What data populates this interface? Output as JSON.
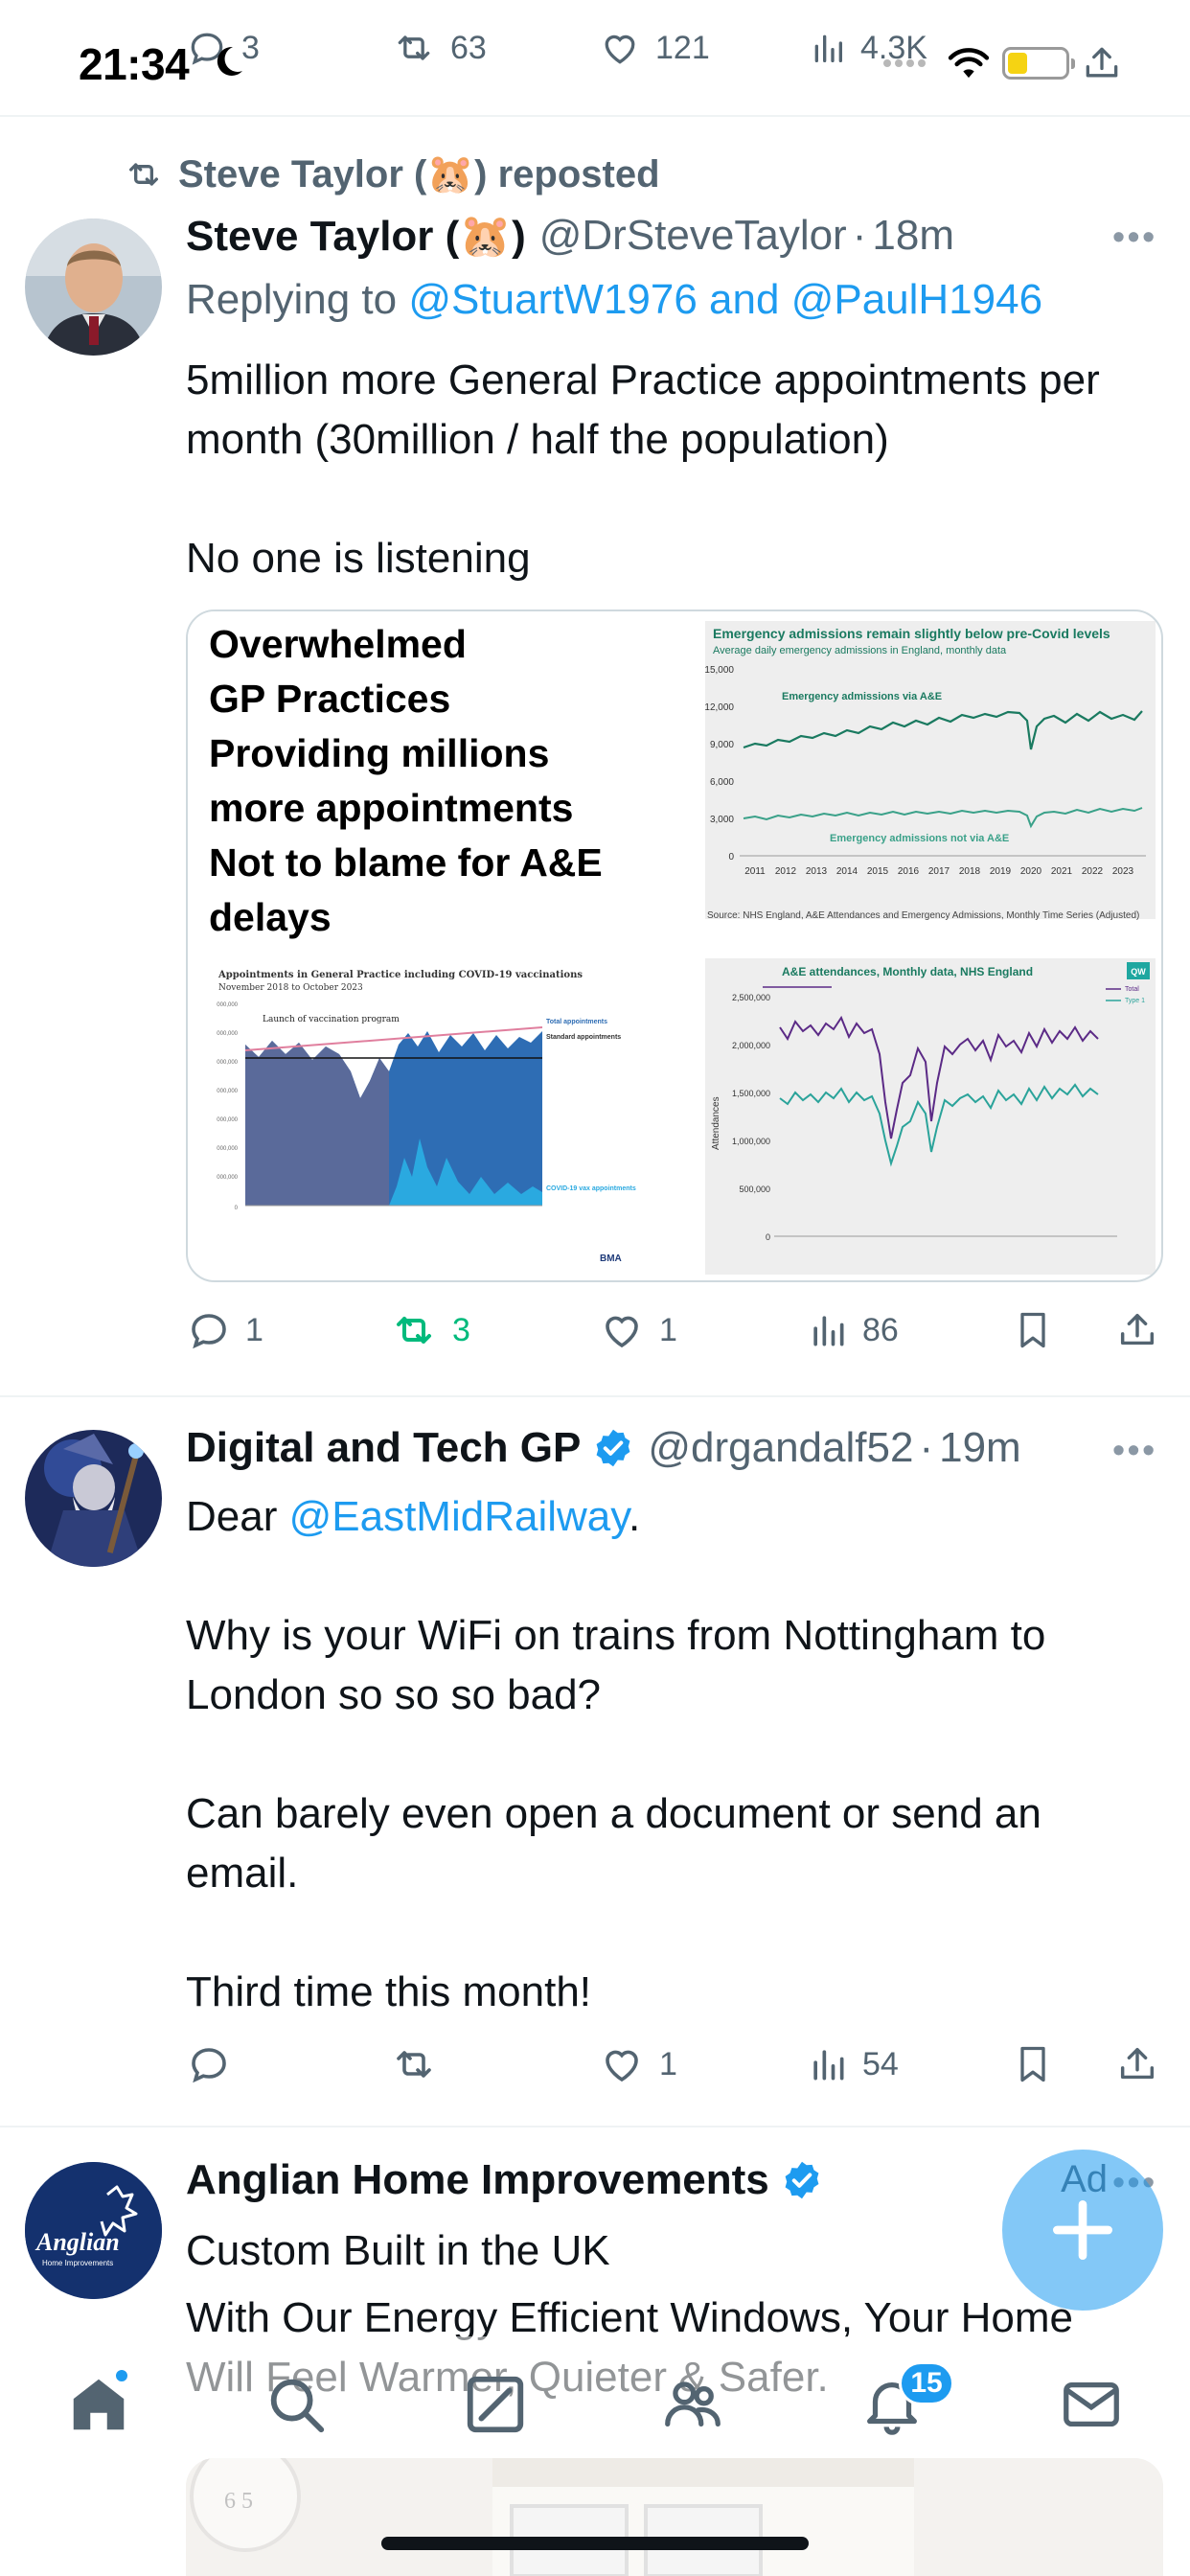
{
  "status_bar": {
    "time": "21:34"
  },
  "prev_tweet": {
    "reply_count": "3",
    "repost_count": "63",
    "like_count": "121",
    "view_count": "4.3K"
  },
  "tweet1": {
    "retweet_context": "Steve Taylor (🐹) reposted",
    "display_name": "Steve Taylor (🐹)",
    "handle": "@DrSteveTaylor",
    "time": "18m",
    "reply_prefix": "Replying to ",
    "reply_mentions": "@StuartW1976 and @PaulH1946",
    "text_line1": "5million more General Practice appointments per month (30million / half the population)",
    "text_line2": "No one is listening",
    "media": {
      "headline": [
        "Overwhelmed",
        "GP Practices",
        "Providing millions",
        "more appointments",
        "Not to blame for A&E",
        "delays"
      ],
      "chart1": {
        "title": "Emergency admissions remain slightly below pre-Covid levels",
        "subtitle": "Average daily emergency admissions in England, monthly data",
        "series_a": "Emergency admissions via A&E",
        "series_b": "Emergency admissions not via A&E",
        "source": "Source: NHS England, A&E Attendances and Emergency Admissions, Monthly Time Series (Adjusted)"
      },
      "chart2": {
        "title": "Appointments in General Practice including COVID-19 vaccinations",
        "subtitle": "November 2018 to October 2023",
        "launch": "Launch of vaccination program",
        "legend_total": "Total appointments",
        "legend_standard": "Standard appointments",
        "legend_covid": "COVID-19 vax appointments",
        "brand": "BMA"
      },
      "chart3": {
        "title": "A&E attendances, Monthly data, NHS England",
        "ylabel": "Attendances",
        "legend_total": "Total",
        "legend_type1": "Type 1",
        "brand": "QW"
      }
    },
    "reply_count": "1",
    "repost_count": "3",
    "like_count": "1",
    "view_count": "86"
  },
  "tweet2": {
    "display_name": "Digital and Tech GP",
    "handle": "@drgandalf52",
    "time": "19m",
    "greeting": "Dear ",
    "mention": "@EastMidRailway",
    "greeting_end": ".",
    "para1": "Why is your WiFi on trains from Nottingham to London so so so bad?",
    "para2": "Can barely even open a document or send an email.",
    "para3": "Third time this month!",
    "like_count": "1",
    "view_count": "54"
  },
  "ad": {
    "display_name": "Anglian Home Improvements",
    "label": "Ad",
    "headline": "Custom Built in the UK",
    "text": "With Our Energy Efficient Windows, Your Home Will Feel Warmer, Quieter & Safer.",
    "logo_text": "Anglian",
    "logo_sub": "Home Improvements"
  },
  "nav": {
    "notification_badge": "15"
  },
  "colors": {
    "accent": "#1d9bf0",
    "repost_green": "#00ba7c",
    "muted": "#536471",
    "chart_teal": "#1a7a60",
    "chart_purple": "#5b2a86"
  }
}
